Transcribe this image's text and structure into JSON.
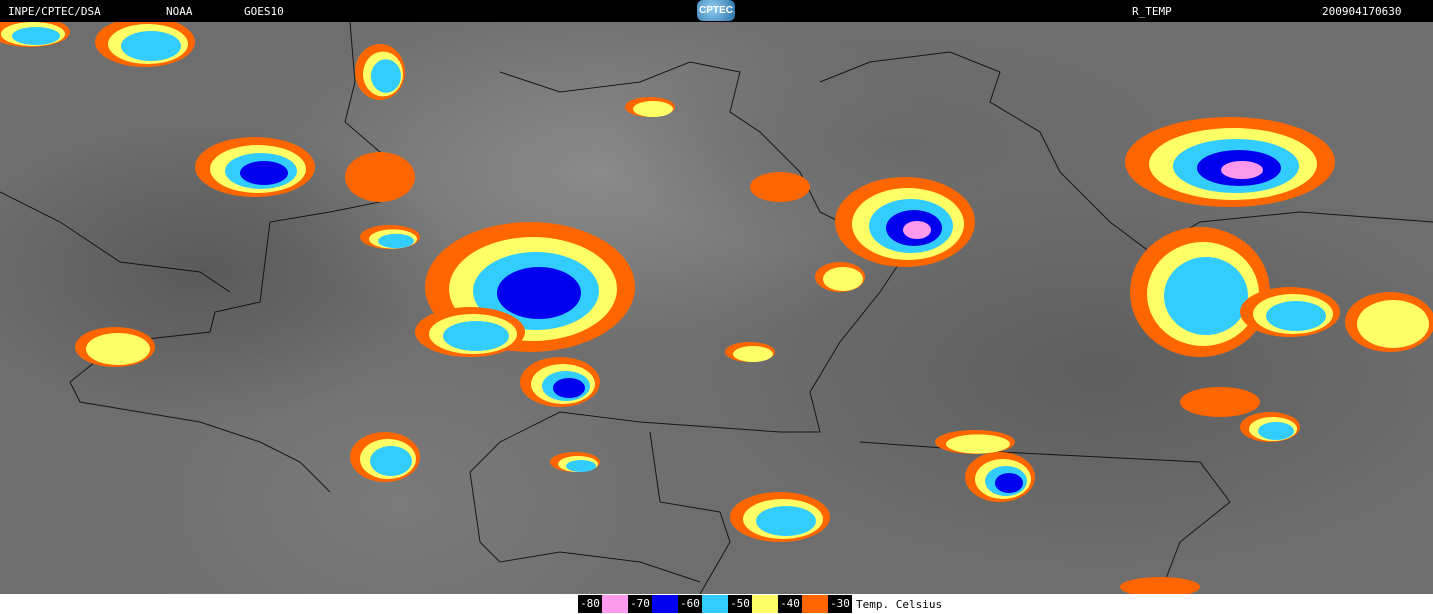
{
  "header": {
    "source": "INPE/CPTEC/DSA",
    "agency": "NOAA",
    "satellite": "GOES10",
    "logo_text": "CPTEC",
    "product": "R_TEMP",
    "timestamp": "200904170630"
  },
  "legend": {
    "title": "Temp. Celsius",
    "entries": [
      {
        "label": "-80",
        "color": "#ff99ee"
      },
      {
        "label": "-70",
        "color": "#0000ee"
      },
      {
        "label": "-60",
        "color": "#33ccff"
      },
      {
        "label": "-50",
        "color": "#ffff66"
      },
      {
        "label": "-40",
        "color": "#ff6600"
      },
      {
        "label": "-30",
        "color": null
      }
    ]
  }
}
